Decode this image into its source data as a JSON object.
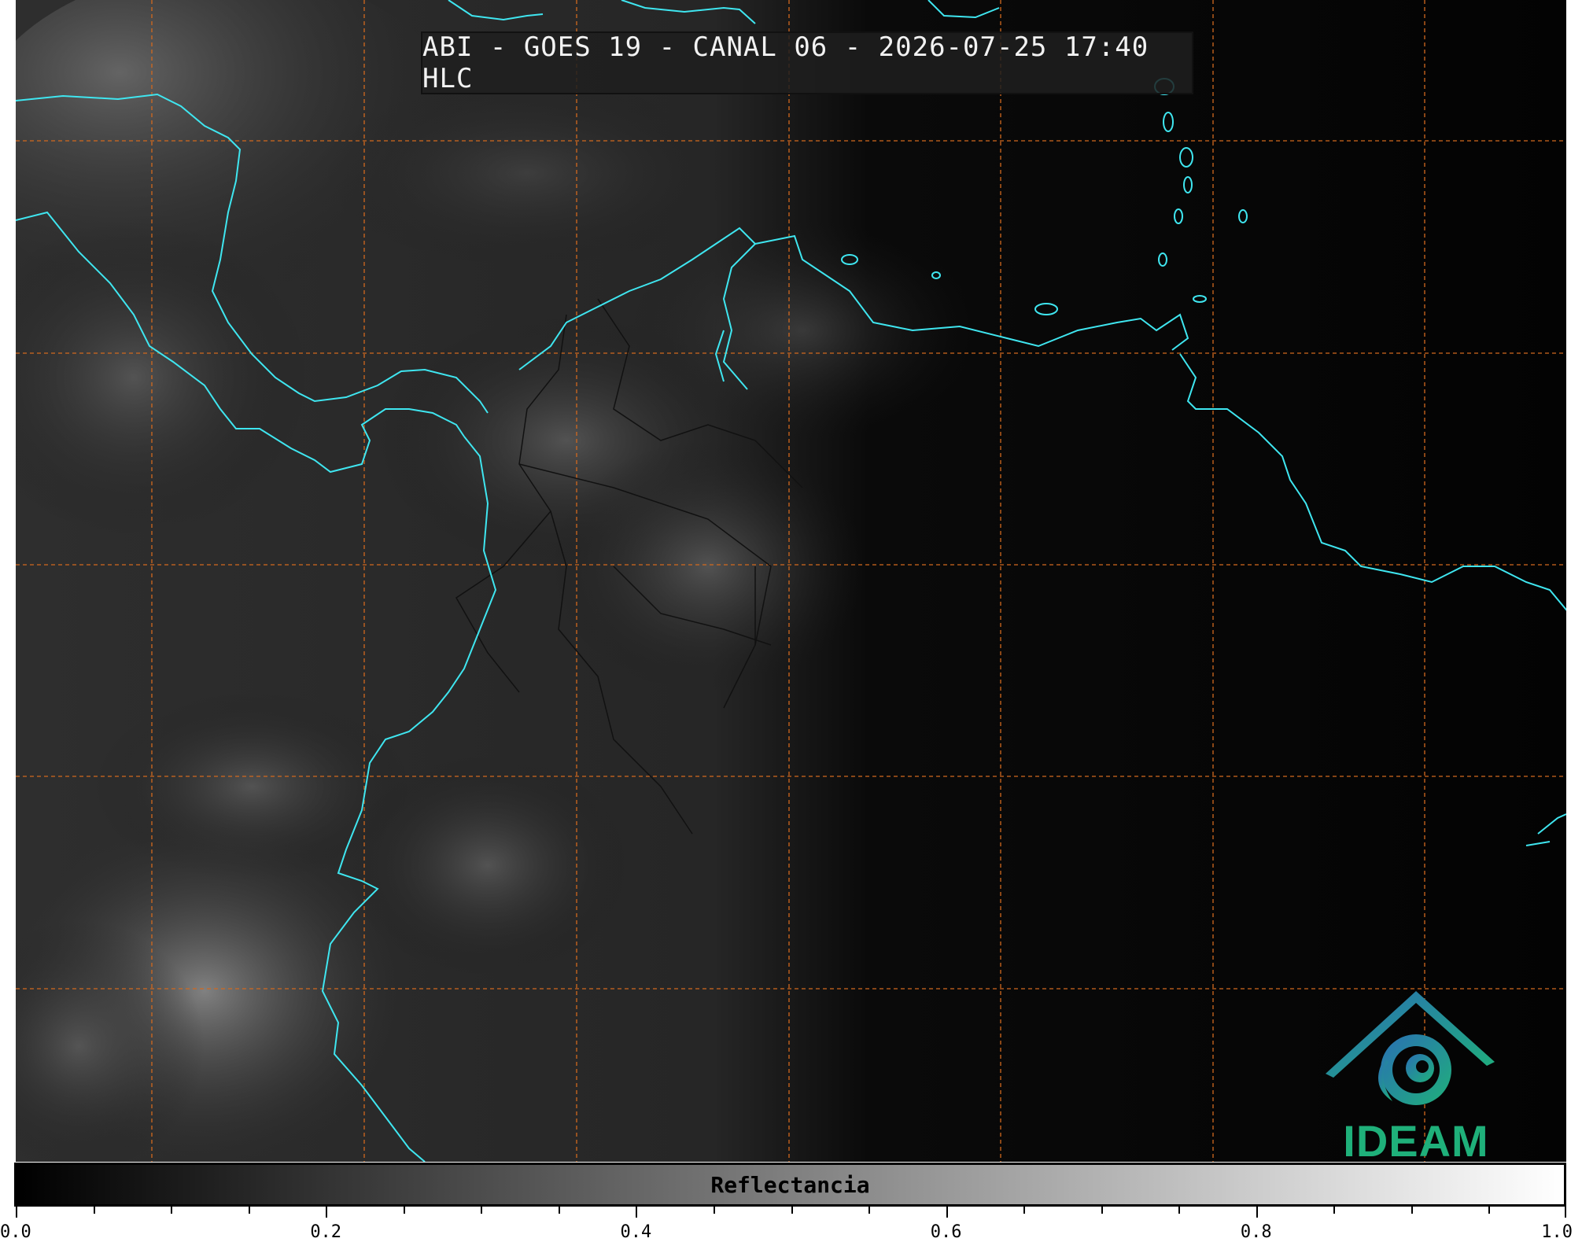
{
  "title": "ABI - GOES 19 - CANAL 06 - 2026-07-25 17:40 HLC",
  "logo": {
    "text": "IDEAM",
    "color_primary": "#1fb07a",
    "color_secondary": "#2a6fb5"
  },
  "colorbar": {
    "label": "Reflectancia",
    "min": 0.0,
    "max": 1.0,
    "ticks": [
      "0.0",
      "0.2",
      "0.4",
      "0.6",
      "0.8",
      "1.0"
    ],
    "colormap": "grayscale"
  },
  "map": {
    "coastline_color": "#3fe6f0",
    "gridline_color": "#d2691e",
    "border_color": "#111111"
  }
}
